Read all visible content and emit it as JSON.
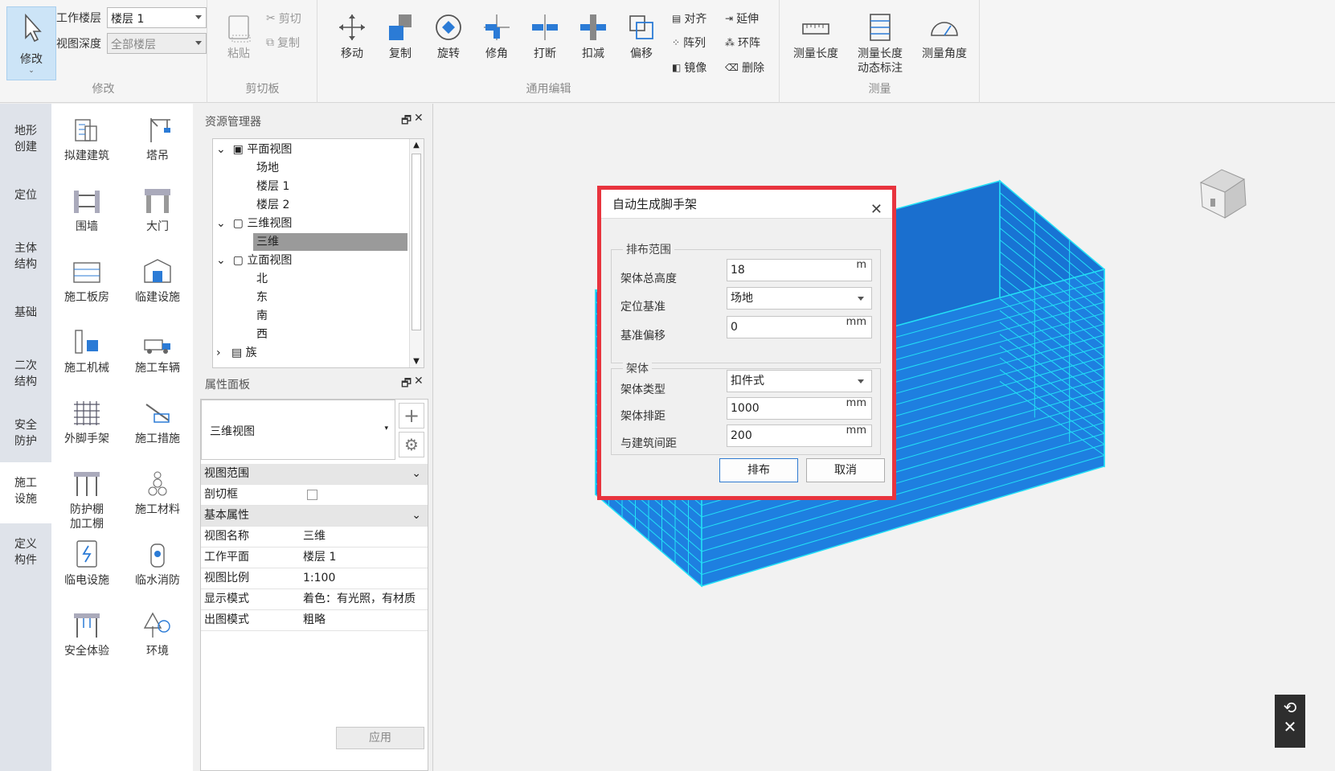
{
  "ribbon": {
    "modify_label": "修改",
    "work_floor_label": "工作楼层",
    "work_floor_value": "楼层 1",
    "view_depth_label": "视图深度",
    "view_depth_value": "全部楼层",
    "groups": {
      "modify": "修改",
      "clipboard": "剪切板",
      "edit": "通用编辑",
      "measure": "测量"
    },
    "clipboard": {
      "paste": "粘贴",
      "cut": "剪切",
      "copy": "复制"
    },
    "edit": {
      "move": "移动",
      "duplicate": "复制",
      "rotate": "旋转",
      "trim": "修角",
      "break": "打断",
      "subtract": "扣减",
      "offset": "偏移",
      "align": "对齐",
      "array": "阵列",
      "mirror": "镜像",
      "extend": "延伸",
      "ring_array": "环阵",
      "delete": "删除"
    },
    "measure": {
      "length": "测量长度",
      "dynamic_line1": "测量长度",
      "dynamic_line2": "动态标注",
      "angle": "测量角度"
    }
  },
  "categories": [
    {
      "line1": "地形",
      "line2": "创建"
    },
    {
      "line1": "定位",
      "line2": ""
    },
    {
      "line1": "主体",
      "line2": "结构"
    },
    {
      "line1": "基础",
      "line2": ""
    },
    {
      "line1": "二次",
      "line2": "结构"
    },
    {
      "line1": "安全",
      "line2": "防护"
    },
    {
      "line1": "施工",
      "line2": "设施"
    },
    {
      "line1": "定义",
      "line2": "构件"
    }
  ],
  "palette": [
    {
      "label": "拟建建筑",
      "icon": "building-icon"
    },
    {
      "label": "塔吊",
      "icon": "tower-crane-icon"
    },
    {
      "label": "围墙",
      "icon": "fence-icon"
    },
    {
      "label": "大门",
      "icon": "gate-icon"
    },
    {
      "label": "施工板房",
      "icon": "site-office-icon"
    },
    {
      "label": "临建设施",
      "icon": "temp-facility-icon"
    },
    {
      "label": "施工机械",
      "icon": "machinery-icon"
    },
    {
      "label": "施工车辆",
      "icon": "truck-icon"
    },
    {
      "label": "外脚手架",
      "icon": "scaffold-icon"
    },
    {
      "label": "施工措施",
      "icon": "measure-icon"
    },
    {
      "label": "防护棚\n加工棚",
      "icon": "shed-icon"
    },
    {
      "label": "施工材料",
      "icon": "materials-icon"
    },
    {
      "label": "临电设施",
      "icon": "electric-icon"
    },
    {
      "label": "临水消防",
      "icon": "hydrant-icon"
    },
    {
      "label": "安全体验",
      "icon": "safety-experience-icon"
    },
    {
      "label": "环境",
      "icon": "environment-icon"
    }
  ],
  "resource_manager": {
    "title": "资源管理器",
    "nodes": {
      "plan": "平面视图",
      "site": "场地",
      "floor1": "楼层 1",
      "floor2": "楼层 2",
      "view3d": "三维视图",
      "view3d_child": "三维",
      "elevation": "立面视图",
      "north": "北",
      "east": "东",
      "south": "南",
      "west": "西",
      "family": "族"
    }
  },
  "properties": {
    "title": "属性面板",
    "type_value": "三维视图",
    "group1": "视图范围",
    "section_box": "剖切框",
    "group2": "基本属性",
    "rows": [
      {
        "k": "视图名称",
        "v": "三维"
      },
      {
        "k": "工作平面",
        "v": "楼层 1"
      },
      {
        "k": "视图比例",
        "v": "1:100"
      },
      {
        "k": "显示模式",
        "v": "着色：有光照，有材质"
      },
      {
        "k": "出图模式",
        "v": "粗略"
      }
    ],
    "apply": "应用"
  },
  "dialog": {
    "title": "自动生成脚手架",
    "section1": "排布范围",
    "total_height_label": "架体总高度",
    "total_height_value": "18",
    "total_height_unit": "m",
    "base_label": "定位基准",
    "base_value": "场地",
    "offset_label": "基准偏移",
    "offset_value": "0",
    "offset_unit": "mm",
    "section2": "架体",
    "type_label": "架体类型",
    "type_value": "扣件式",
    "row_spacing_label": "架体排距",
    "row_spacing_value": "1000",
    "row_spacing_unit": "mm",
    "distance_label": "与建筑间距",
    "distance_value": "200",
    "distance_unit": "mm",
    "ok": "排布",
    "cancel": "取消"
  },
  "colors": {
    "scaffold_fill": "#1e7fe0",
    "scaffold_line": "#23e0f5",
    "dialog_border": "#e8343e"
  }
}
